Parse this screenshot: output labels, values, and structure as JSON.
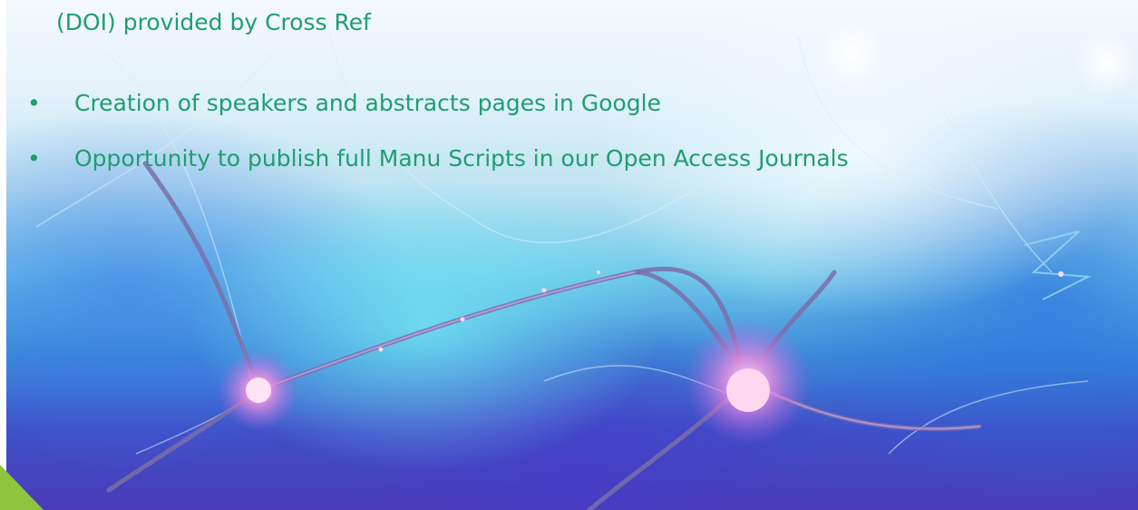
{
  "slide": {
    "bullet_glyph": "•",
    "items": [
      {
        "text": "(DOI) provided by Cross Ref",
        "bulleted": false
      },
      {
        "text": "Creation of speakers and abstracts pages in Google",
        "bulleted": true
      },
      {
        "text": "Opportunity to publish full Manu Scripts in our Open Access Journals",
        "bulleted": true
      }
    ]
  },
  "colors": {
    "text": "#1f9e6f",
    "accent_triangle": "#8cc63f"
  }
}
